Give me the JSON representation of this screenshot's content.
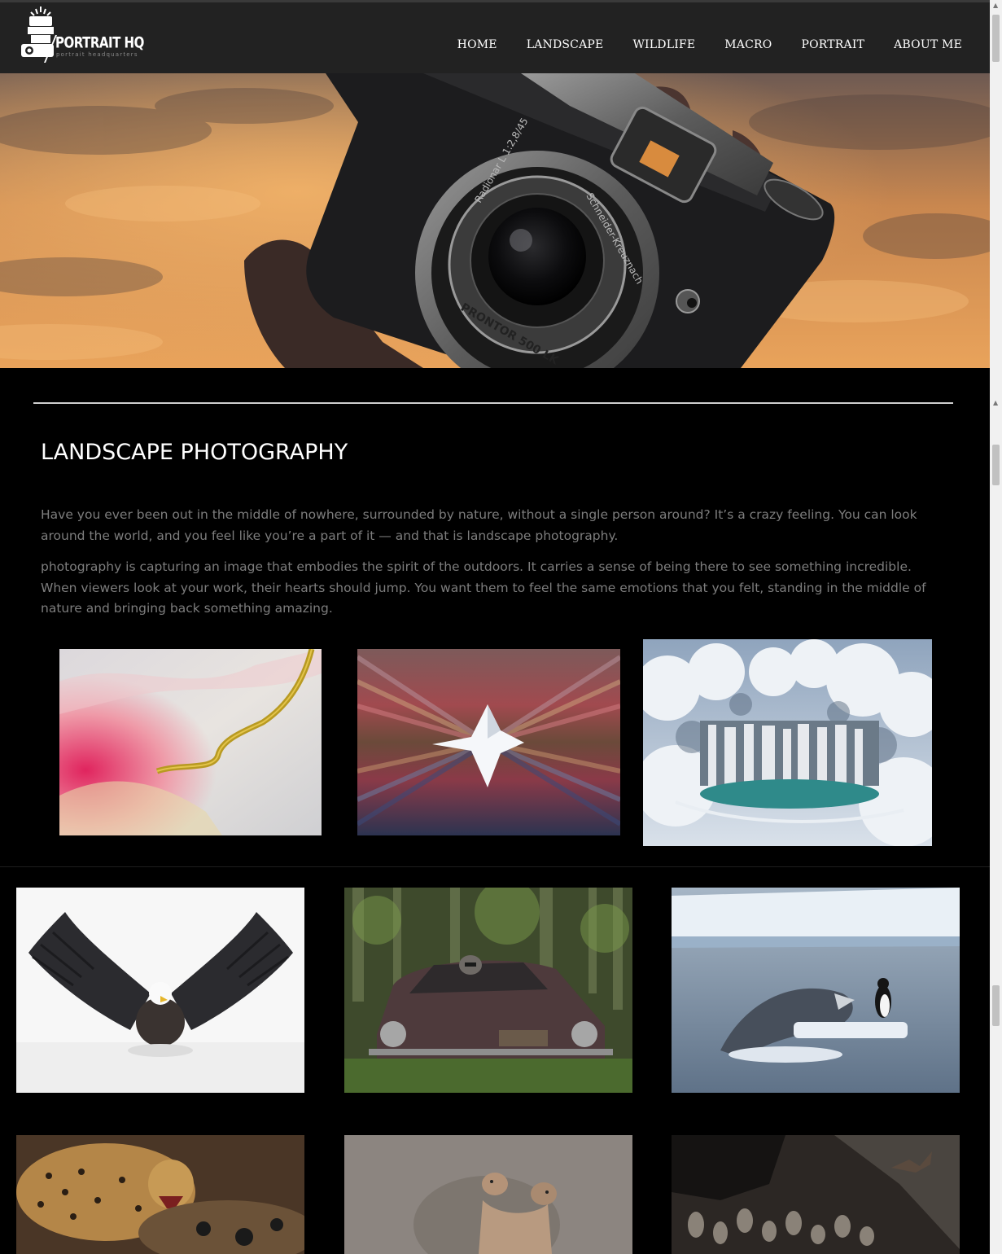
{
  "brand": {
    "name": "PORTRAIT HQ",
    "tagline": "portrait headquarters"
  },
  "nav": {
    "items": [
      {
        "label": "HOME"
      },
      {
        "label": "LANDSCAPE"
      },
      {
        "label": "WILDLIFE"
      },
      {
        "label": "MACRO"
      },
      {
        "label": "PORTRAIT"
      },
      {
        "label": "ABOUT ME"
      }
    ]
  },
  "hero": {
    "lens_text_1": "Radionar L 1:2,8/45",
    "lens_text_2": "Schneider-Kreuznach",
    "lens_text_3": "PRONTOR 500 LK"
  },
  "section": {
    "title": "LANDSCAPE PHOTOGRAPHY",
    "paragraph_1": "Have you ever been out in the middle of nowhere, surrounded by nature, without a single person around? It’s a crazy feeling. You can look around the world, and you feel like you’re a part of it — and that is landscape photography.",
    "paragraph_2": "photography is capturing an image that embodies the spirit of the outdoors. It carries a sense of being there to see something incredible. When viewers look at your work, their hearts should jump. You want them to feel the same emotions that you felt, standing in the middle of nature and bringing back something amazing."
  },
  "colors": {
    "header_bg": "#222222",
    "page_bg": "#000000",
    "body_text": "#7d7d7d",
    "sky_orange": "#e8a35a"
  }
}
